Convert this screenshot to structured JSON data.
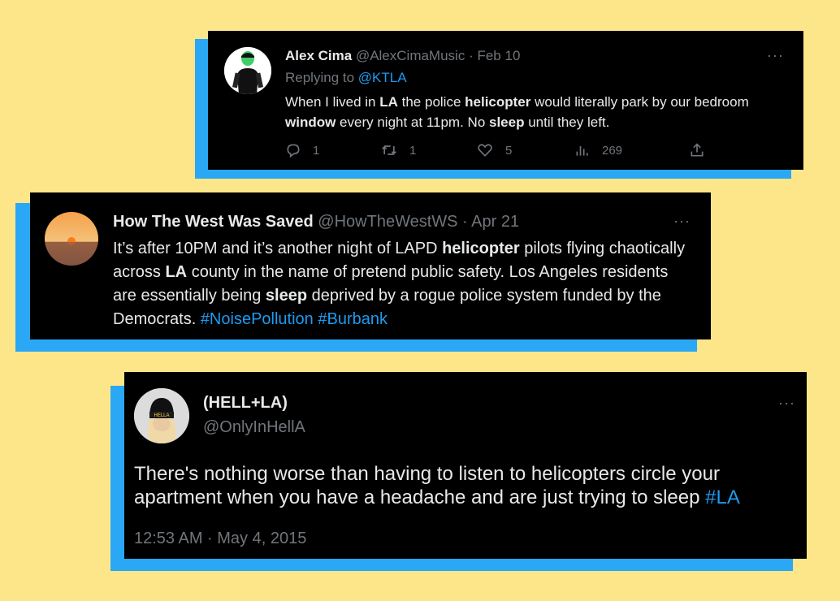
{
  "colors": {
    "background": "#fde68a",
    "shadow": "#2aa7f5",
    "card": "#000000",
    "link": "#1d9bf0",
    "muted": "#71767b"
  },
  "tweet1": {
    "name": "Alex Cima",
    "handle": "@AlexCimaMusic",
    "sep": "·",
    "date": "Feb 10",
    "replying_to_label": "Replying to",
    "replying_to_handle": "@KTLA",
    "text_parts": [
      "When I lived in ",
      "LA",
      " the police ",
      "helicopter",
      " would literally park by our bedroom ",
      "window",
      " every night at 11pm. No ",
      "sleep",
      " until they left."
    ],
    "replies": "1",
    "retweets": "1",
    "likes": "5",
    "views": "269",
    "icons": [
      "reply-icon",
      "retweet-icon",
      "like-icon",
      "views-icon",
      "share-icon"
    ]
  },
  "tweet2": {
    "name": "How The West Was Saved",
    "handle": "@HowTheWestWS",
    "sep": "·",
    "date": "Apr 21",
    "text_parts": [
      "It’s after 10PM and it’s another night of LAPD ",
      "helicopter",
      " pilots flying chaotically across ",
      "LA",
      " county in the name of pretend public safety. Los Angeles residents are essentially being ",
      "sleep",
      " deprived by a rogue police system funded by the Democrats. "
    ],
    "hashtags": [
      "#NoisePollution",
      "#Burbank"
    ]
  },
  "tweet3": {
    "name": "(HELL+LA)",
    "handle": "@OnlyInHellA",
    "avatar_beanie_text": "HELLA",
    "text": "There's nothing worse than having to listen to helicopters circle your apartment when you have a headache and are just trying to sleep ",
    "hashtag": "#LA",
    "timestamp": "12:53 AM · May 4, 2015"
  },
  "more_label": "···"
}
